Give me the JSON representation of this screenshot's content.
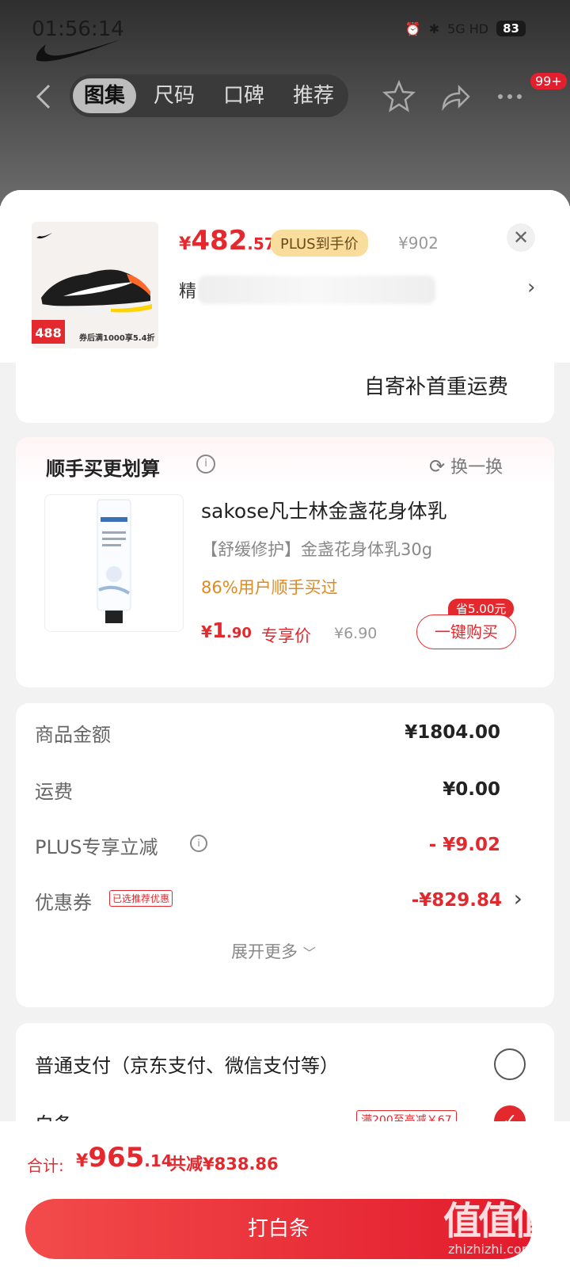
{
  "status_bar": {
    "time": "01:56:14",
    "network": "5G HD",
    "battery": "83"
  },
  "nav": {
    "tabs": [
      "图集",
      "尺码",
      "口碑",
      "推荐"
    ],
    "active_tab": "图集",
    "message_badge": "99+"
  },
  "product": {
    "price_currency": "¥",
    "price_int": "482",
    "price_dec": ".57",
    "plus_tag": "PLUS到手价",
    "original_price": "¥902",
    "variant_prefix": "精",
    "thumb_badge_price": "488",
    "thumb_caption": "券后满1000享5.4折"
  },
  "shipping_note": "自寄补首重运费",
  "addon": {
    "title": "顺手买更划算",
    "refresh_label": "换一换",
    "name": "sakose凡士林金盏花身体乳",
    "subtitle": "【舒缓修护】金盏花身体乳30g",
    "social_proof": "86%用户顺手买过",
    "price_currency": "¥",
    "price_int": "1",
    "price_dec": ".90",
    "price_label": "专享价",
    "original_price": "¥6.90",
    "save_badge": "省5.00元",
    "buy_button": "一键购买"
  },
  "summary": {
    "rows": [
      {
        "label": "商品金额",
        "value": "¥1804.00"
      },
      {
        "label": "运费",
        "value": "¥0.00"
      },
      {
        "label": "PLUS专享立减",
        "value": "- ¥9.02"
      },
      {
        "label": "优惠券",
        "value": "-¥829.84",
        "tag": "已选推荐优惠"
      }
    ],
    "expand": "展开更多"
  },
  "payment": {
    "option1": "普通支付（京东支付、微信支付等）",
    "option2": "白条",
    "option2_promo": "满200至高减￥67"
  },
  "footer": {
    "total_label": "合计:",
    "total_currency": "¥",
    "total_int": "965",
    "total_dec": ".14",
    "saved": "共减¥838.86",
    "pay_button": "打白条",
    "watermark": "值",
    "watermark_url": "zhizhizhi.com"
  },
  "colors": {
    "accent": "#e4292e",
    "plus_gold": "#f9dd9d",
    "orange_text": "#e08a1e"
  }
}
